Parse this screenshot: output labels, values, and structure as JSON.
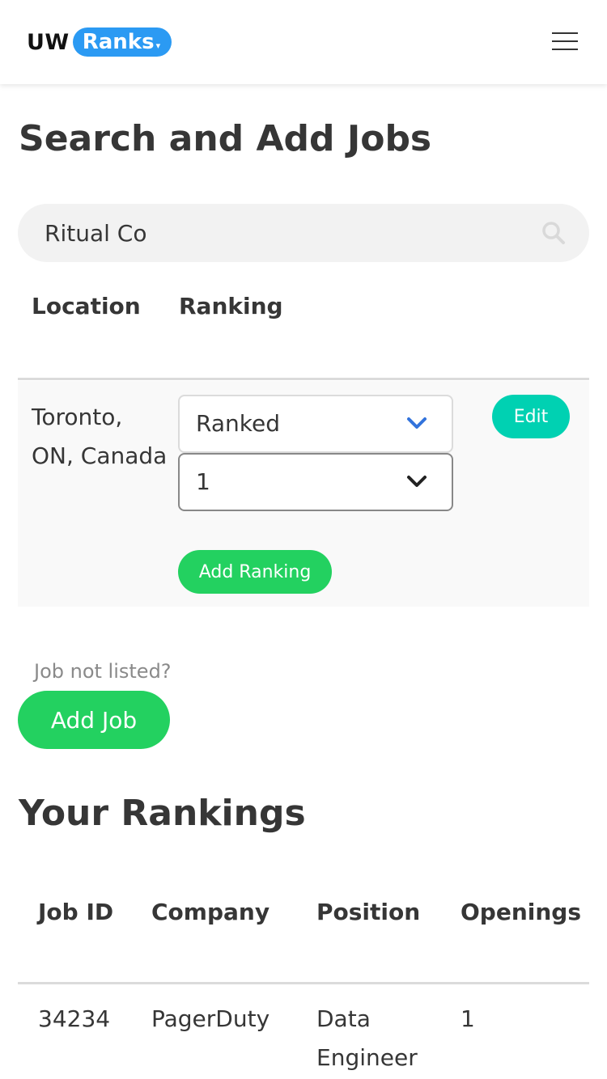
{
  "navbar": {
    "brand_uw": "UW",
    "brand_ranks": "Ranks",
    "brand_caret": "▾"
  },
  "search_section": {
    "title": "Search and Add Jobs",
    "search_value": "Ritual Co",
    "columns": [
      "Location",
      "Ranking"
    ],
    "result": {
      "location": "Toronto, ON, Canada",
      "status_select": "Ranked",
      "rank_select": "1",
      "edit_label": "Edit",
      "add_ranking_label": "Add Ranking"
    },
    "not_listed_text": "Job not listed?",
    "add_job_label": "Add Job"
  },
  "rankings": {
    "title": "Your Rankings",
    "columns": [
      "Job ID",
      "Company",
      "Position",
      "Openings"
    ],
    "rows": [
      {
        "job_id": "34234",
        "company": "PagerDuty",
        "position": "Data Engineer",
        "openings": "1"
      }
    ]
  },
  "colors": {
    "brand_blue": "#2b9af3",
    "primary_teal": "#00d1b2",
    "success_green": "#23d160",
    "chevron_blue": "#3273dc"
  },
  "icons": {
    "menu": "hamburger-icon",
    "search": "search-icon",
    "dropdown": "chevron-down-icon"
  }
}
